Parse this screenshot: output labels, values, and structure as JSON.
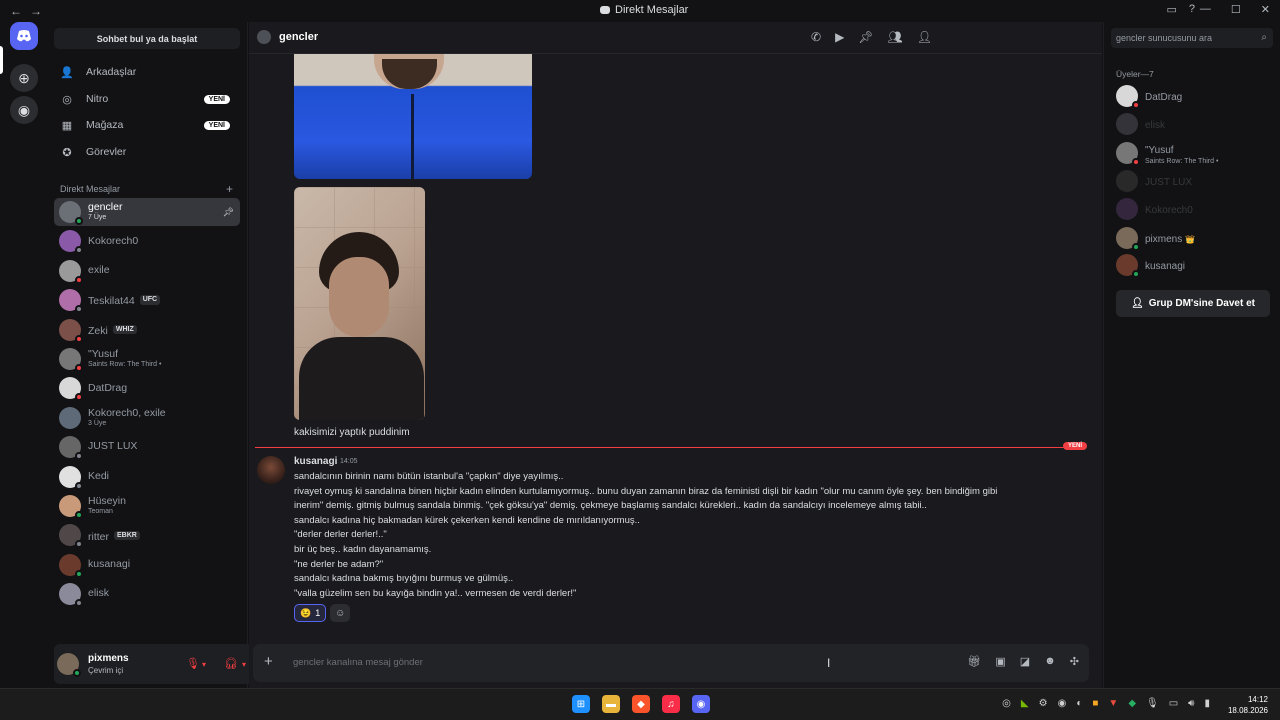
{
  "titlebar": {
    "title": "Direkt Mesajlar",
    "back": "←",
    "forward": "→"
  },
  "sidebar": {
    "search_label": "Sohbet bul ya da başlat",
    "nav": [
      {
        "label": "Arkadaşlar",
        "icon": "friends-icon"
      },
      {
        "label": "Nitro",
        "icon": "nitro-icon",
        "badge": "YENİ"
      },
      {
        "label": "Mağaza",
        "icon": "shop-icon",
        "badge": "YENİ"
      },
      {
        "label": "Görevler",
        "icon": "quests-icon"
      }
    ],
    "dm_header": "Direkt Mesajlar",
    "dms": [
      {
        "name": "gencler",
        "sub": "7 Üye",
        "status": "on",
        "active": true,
        "color": "#6b6f76"
      },
      {
        "name": "Kokorech0",
        "status": "off",
        "color": "#8a5aa8"
      },
      {
        "name": "exile",
        "status": "dnd",
        "color": "#9a9a9a"
      },
      {
        "name": "Teskilat44",
        "tag": "UFC",
        "status": "off",
        "color": "#b06ea8"
      },
      {
        "name": "Zeki",
        "tag": "WHIZ",
        "status": "dnd",
        "color": "#7a5048"
      },
      {
        "name": "\"Yusuf",
        "sub": "Saints Row: The Third •",
        "status": "dnd",
        "color": "#777"
      },
      {
        "name": "DatDrag",
        "status": "dnd",
        "color": "#d8d8d8"
      },
      {
        "name": "Kokorech0, exile",
        "sub": "3 Üye",
        "color": "#5e6a78"
      },
      {
        "name": "JUST LUX",
        "status": "off",
        "color": "#666"
      },
      {
        "name": "Kedi",
        "status": "off",
        "color": "#e0e0e0"
      },
      {
        "name": "Hüseyin",
        "sub": "Teoman",
        "status": "on",
        "color": "#c89a7a"
      },
      {
        "name": "ritter",
        "tag": "EBKR",
        "status": "off",
        "color": "#504848"
      },
      {
        "name": "kusanagi",
        "status": "on",
        "color": "#6a3a2c"
      },
      {
        "name": "elisk",
        "status": "off",
        "color": "#8a8a9a"
      }
    ]
  },
  "user": {
    "name": "pixmens",
    "status": "Çevrim içi"
  },
  "chat": {
    "group_name": "gencler",
    "caption": "kakisimizi yaptık puddinim",
    "new_label": "YENİ",
    "message": {
      "author": "kusanagi",
      "time": "14:05",
      "lines": [
        "sandalcının birinin namı bütün istanbul'a \"çapkın\" diye yayılmış..",
        "rivayet oymuş ki sandalına binen hiçbir kadın elinden kurtulamıyormuş.. bunu duyan zamanın biraz da feministi dişli bir kadın \"olur mu canım öyle şey. ben bindiğim gibi",
        "inerim\" demiş. gitmiş bulmuş sandala binmiş. \"çek göksu'ya\" demiş. çekmeye başlamış sandalcı kürekleri.. kadın da sandalcıyı incelemeye almış tabii..",
        "sandalcı kadına hiç bakmadan kürek çekerken kendi kendine de mırıldanıyormuş..",
        "\"derler derler derler!..\"",
        "bir üç beş.. kadın dayanamamış.",
        "\"ne derler be adam?\"",
        "sandalcı kadına bakmış bıyığını burmuş ve gülmüş..",
        "\"valla güzelim sen bu kayığa bindin ya!.. vermesen de verdi derler!\""
      ],
      "reaction_emoji": "😉",
      "reaction_count": "1"
    },
    "composer_placeholder": "gencler kanalına mesaj gönder"
  },
  "members": {
    "search_placeholder": "gencler sunucusunu ara",
    "header": "Üyeler—7",
    "list": [
      {
        "name": "DatDrag",
        "status": "dnd",
        "color": "#d8d8d8"
      },
      {
        "name": "elisk",
        "offline": true,
        "color": "#8a8a9a"
      },
      {
        "name": "\"Yusuf",
        "sub": "Saints Row: The Third •",
        "status": "dnd",
        "color": "#777"
      },
      {
        "name": "JUST LUX",
        "offline": true,
        "color": "#666"
      },
      {
        "name": "Kokorech0",
        "offline": true,
        "color": "#8a5aa8"
      },
      {
        "name": "pixmens",
        "crown": "👑",
        "status": "on",
        "color": "#7a6a5a"
      },
      {
        "name": "kusanagi",
        "status": "on",
        "color": "#6a3a2c"
      }
    ],
    "invite_label": "Grup DM'sine Davet et"
  },
  "taskbar": {
    "time": "14:12",
    "date": "18.08.2026"
  }
}
